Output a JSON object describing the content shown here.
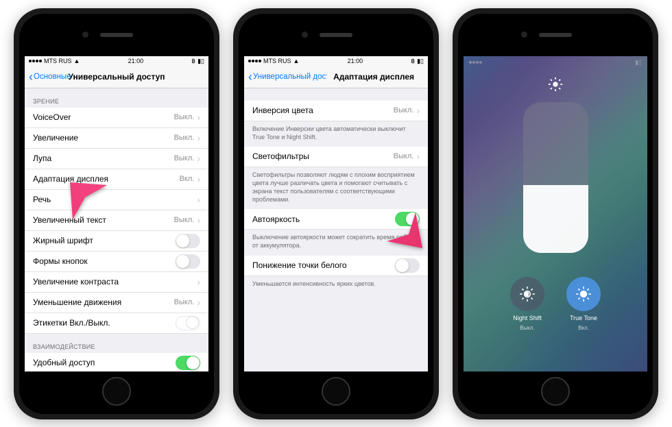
{
  "status": {
    "carrier": "MTS RUS",
    "time": "21:00"
  },
  "phone1": {
    "back": "Основные",
    "title": "Универсальный доступ",
    "section1_header": "ЗРЕНИЕ",
    "items": [
      {
        "label": "VoiceOver",
        "value": "Выкл.",
        "chevron": true
      },
      {
        "label": "Увеличение",
        "value": "Выкл.",
        "chevron": true
      },
      {
        "label": "Лупа",
        "value": "Выкл.",
        "chevron": true
      },
      {
        "label": "Адаптация дисплея",
        "value": "Вкл.",
        "chevron": true
      },
      {
        "label": "Речь",
        "value": "",
        "chevron": true
      },
      {
        "label": "Увеличенный текст",
        "value": "Выкл.",
        "chevron": true
      },
      {
        "label": "Жирный шрифт",
        "toggle": "off"
      },
      {
        "label": "Формы кнопок",
        "toggle": "off"
      },
      {
        "label": "Увеличение контраста",
        "value": "",
        "chevron": true
      },
      {
        "label": "Уменьшение движения",
        "value": "Выкл.",
        "chevron": true
      },
      {
        "label": "Этикетки Вкл./Выкл.",
        "toggle": "outlined"
      }
    ],
    "section2_header": "ВЗАИМОДЕЙСТВИЕ",
    "items2": [
      {
        "label": "Удобный доступ",
        "toggle": "on"
      }
    ]
  },
  "phone2": {
    "back": "Универсальный доступ",
    "title": "Адаптация дисплея",
    "group1": [
      {
        "label": "Инверсия цвета",
        "value": "Выкл.",
        "chevron": true
      }
    ],
    "footer1": "Включение Инверсии цвета автоматически выключит True Tone и Night Shift.",
    "group2": [
      {
        "label": "Светофильтры",
        "value": "Выкл.",
        "chevron": true
      }
    ],
    "footer2": "Светофильтры позволяют людям с плохим восприятием цвета лучше различать цвета и помогают считывать с экрана текст пользователям с соответствующими проблемами.",
    "group3": [
      {
        "label": "Автояркость",
        "toggle": "on"
      }
    ],
    "footer3": "Выключение автояркости может сократить время работы от аккумулятора.",
    "group4": [
      {
        "label": "Понижение точки белого",
        "toggle": "off"
      }
    ],
    "footer4": "Уменьшается интенсивность ярких цветов."
  },
  "phone3": {
    "night_shift_label": "Night Shift",
    "night_shift_value": "Выкл.",
    "true_tone_label": "True Tone",
    "true_tone_value": "Вкл."
  }
}
